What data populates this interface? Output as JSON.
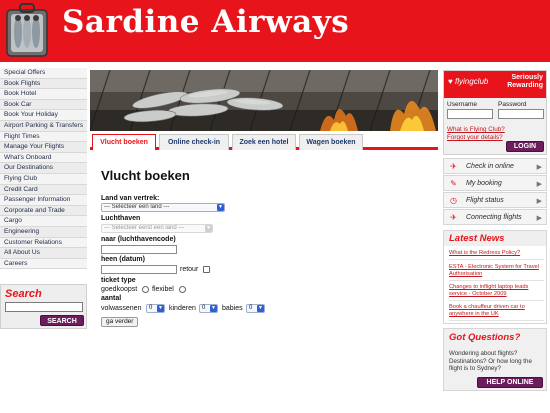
{
  "header": {
    "brand": "Sardine Airways",
    "accent_color": "#e8141b",
    "logo_icon": "sardine-can-icon"
  },
  "left_nav": {
    "items": [
      "Special Offers",
      "Book Flights",
      "Book Hotel",
      "Book Car",
      "Book Your Holiday",
      "Airport Parking & Transfers",
      "Flight Times",
      "Manage Your Flights",
      "What's Onboard",
      "Our Destinations",
      "Flying Club",
      "Credit Card",
      "Passenger Information",
      "Corporate and Trade",
      "Cargo",
      "Engineering",
      "Customer Relations",
      "All About Us",
      "Careers"
    ]
  },
  "search": {
    "title": "Search",
    "button": "SEARCH"
  },
  "tabs": [
    {
      "label": "Vlucht boeken",
      "active": true
    },
    {
      "label": "Online check-in",
      "active": false
    },
    {
      "label": "Zoek een hotel",
      "active": false
    },
    {
      "label": "Wagen boeken",
      "active": false
    }
  ],
  "booking": {
    "title": "Vlucht boeken",
    "departure_label": "Land van vertrek:",
    "departure_select": "--- Selecteer een land ---",
    "airport_label": "Luchthaven",
    "airport_select": "--- Selecteer eerst een land ---",
    "destination_label": "naar (luchthavencode)",
    "outbound_label": "heen (datum)",
    "return_label": "retour",
    "ticket_type_label": "ticket type",
    "ticket_cheapest": "goedkoopst",
    "ticket_flexible": "flexibel",
    "count_label": "aantal",
    "adults_label": "volwassenen",
    "adults_value": "0",
    "children_label": "kinderen",
    "children_value": "0",
    "babies_label": "babies",
    "babies_value": "0",
    "submit": "ga verder"
  },
  "login": {
    "brand": "flyingclub",
    "tagline_1": "Seriously",
    "tagline_2": "Rewarding",
    "username_label": "Username",
    "password_label": "Password",
    "what_is": "What is Flying Club?",
    "forgot": "Forgot your details?",
    "button": "LOGIN"
  },
  "services": [
    {
      "label": "Check in online",
      "icon": "plane-icon"
    },
    {
      "label": "My booking",
      "icon": "pen-icon"
    },
    {
      "label": "Flight status",
      "icon": "clock-icon"
    },
    {
      "label": "Connecting flights",
      "icon": "connecting-plane-icon"
    }
  ],
  "news": {
    "title": "Latest News",
    "items": [
      "What is the Redress Policy?",
      "ESTA - Electronic System for Travel Authorisation",
      "Changes to inflight laptop leads service - October 2009",
      "Book a chauffeur driven car to anywhere in the UK"
    ]
  },
  "questions": {
    "title": "Got Questions?",
    "text": "Wondering about flights? Destinations? Or how long the flight is to Sydney?",
    "button": "HELP ONLINE"
  }
}
